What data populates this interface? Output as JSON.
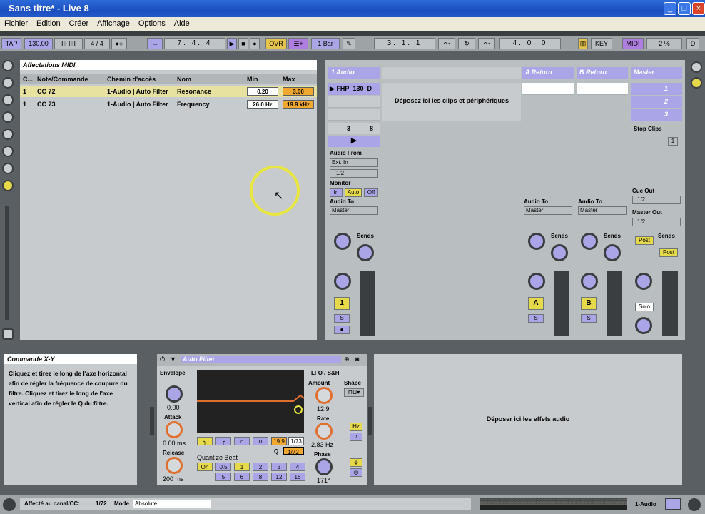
{
  "window": {
    "title": "Sans titre* - Live 8"
  },
  "menu": [
    "Fichier",
    "Edition",
    "Créer",
    "Affichage",
    "Options",
    "Aide"
  ],
  "transport": {
    "tap": "TAP",
    "tempo": "130.00",
    "sig": "4 / 4",
    "position": "7.   4.   4",
    "ovr": "OVR",
    "quant": "1 Bar",
    "loop_start": "3.   1.   1",
    "loop_len": "4.   0.   0",
    "key": "KEY",
    "midi": "MIDI",
    "cpu": "2 %",
    "d": "D"
  },
  "midi_map": {
    "title": "Affectations MIDI",
    "columns": [
      "C...",
      "Note/Commande",
      "Chemin d'accès",
      "Nom",
      "Min",
      "Max"
    ],
    "rows": [
      {
        "ch": "1",
        "note": "CC 72",
        "path": "1-Audio | Auto Filter",
        "name": "Resonance",
        "min": "0.20",
        "max": "3.00"
      },
      {
        "ch": "1",
        "note": "CC 73",
        "path": "1-Audio | Auto Filter",
        "name": "Frequency",
        "min": "26.0 Hz",
        "max": "19.9 kHz"
      }
    ]
  },
  "session": {
    "tracks": [
      "1 Audio",
      "A Return",
      "B Return",
      "Master"
    ],
    "clip": "FHP_130_D",
    "drop_clips": "Déposez ici les clips et périphériques",
    "scenes": [
      "1",
      "2",
      "3"
    ],
    "stop_clips": "Stop Clips",
    "scene_num": "1",
    "audio_from": "Audio From",
    "ext_in": "Ext. In",
    "in_ch": "1/2",
    "monitor": "Monitor",
    "mon_in": "In",
    "mon_auto": "Auto",
    "mon_off": "Off",
    "audio_to": "Audio To",
    "master": "Master",
    "cue_out": "Cue Out",
    "cue_val": "1/2",
    "master_out": "Master Out",
    "master_val": "1/2",
    "sends": "Sends",
    "post": "Post",
    "solo": "Solo",
    "s": "S",
    "track_num": "1",
    "a": "A",
    "b": "B",
    "knob_a": "A",
    "knob_b": "B",
    "io_num": "3",
    "io_num2": "8"
  },
  "info": {
    "title": "Commande X-Y",
    "text": "Cliquez et tirez le long de l'axe horizontal afin de régler la fréquence de coupure du filtre. Cliquez et tirez le long de l'axe vertical afin de régler le Q du filtre."
  },
  "device": {
    "name": "Auto Filter",
    "envelope": "Envelope",
    "env_val": "0.00",
    "attack": "Attack",
    "attack_val": "6.00 ms",
    "release": "Release",
    "release_val": "200 ms",
    "lfo": "LFO / S&H",
    "shape": "Shape",
    "amount": "Amount",
    "amount_val": "12.9",
    "rate": "Rate",
    "rate_val": "2.83 Hz",
    "phase": "Phase",
    "phase_val": "171°",
    "hz": "Hz",
    "freq": "19.9",
    "freq2": "1/73",
    "q": "Q",
    "q_val": "1/72",
    "quantize": "Quantize Beat",
    "on": "On",
    "qbeats": [
      "0.5",
      "1",
      "2",
      "3",
      "4",
      "5",
      "6",
      "8",
      "12",
      "16"
    ]
  },
  "drop_fx": "Déposer ici les effets audio",
  "status": {
    "label": "Affecté au canal/CC:",
    "value": "1/72",
    "mode_label": "Mode",
    "mode": "Absolute",
    "track": "1-Audio"
  },
  "colors": {
    "accent": "#a9a5e6",
    "yellow": "#e6d94a",
    "orange": "#f0a830"
  }
}
